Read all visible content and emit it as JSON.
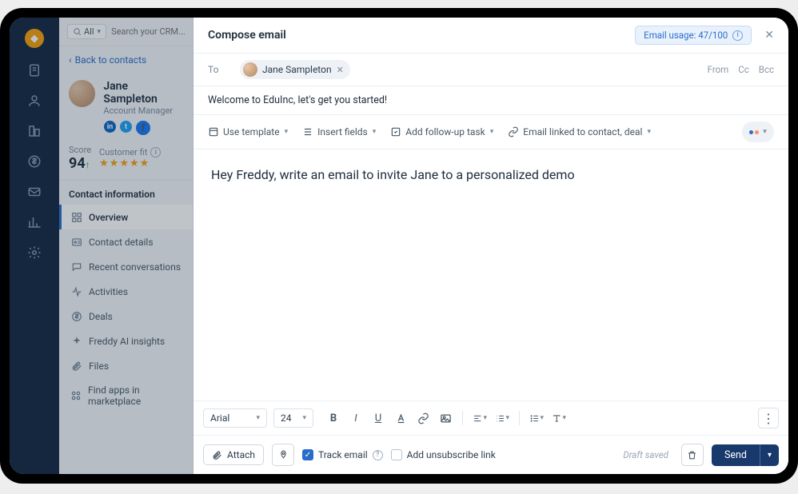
{
  "rail": {
    "icons": [
      "logo",
      "doc",
      "contact",
      "org",
      "deal",
      "mail",
      "report",
      "settings"
    ]
  },
  "search": {
    "filter_label": "All",
    "placeholder": "Search your CRM..."
  },
  "backlink": "Back to contacts",
  "contact": {
    "name": "Jane Sampleton",
    "title": "Account Manager",
    "score_label": "Score",
    "score_value": "94",
    "fit_label": "Customer fit",
    "stars": "★★★★★"
  },
  "section_title": "Contact information",
  "nav": [
    {
      "key": "overview",
      "label": "Overview",
      "active": true
    },
    {
      "key": "details",
      "label": "Contact details"
    },
    {
      "key": "recent",
      "label": "Recent conversations"
    },
    {
      "key": "activities",
      "label": "Activities"
    },
    {
      "key": "deals",
      "label": "Deals"
    },
    {
      "key": "freddy",
      "label": "Freddy AI insights"
    },
    {
      "key": "files",
      "label": "Files"
    },
    {
      "key": "marketplace",
      "label": "Find apps in marketplace"
    }
  ],
  "compose": {
    "title": "Compose email",
    "usage": "Email usage: 47/100",
    "to_label": "To",
    "recipient": "Jane Sampleton",
    "from": "From",
    "cc": "Cc",
    "bcc": "Bcc",
    "subject": "Welcome to EduInc, let's get you started!",
    "template": "Use template",
    "insert": "Insert fields",
    "followup": "Add follow-up task",
    "linked": "Email linked to contact, deal",
    "body": "Hey Freddy, write an email to invite Jane to a personalized demo",
    "font_family": "Arial",
    "font_size": "24",
    "attach": "Attach",
    "track": "Track email",
    "unsubscribe": "Add unsubscribe link",
    "draft": "Draft saved",
    "send": "Send"
  }
}
